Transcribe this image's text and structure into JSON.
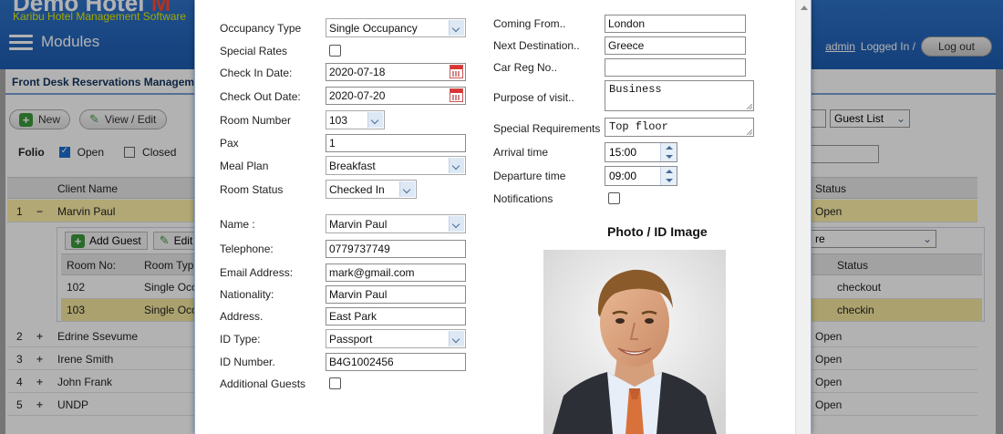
{
  "app": {
    "title_main": "Demo Hotel",
    "title_extra": "M",
    "subtitle": "Karibu Hotel Management Software",
    "modules": "Modules",
    "user": "admin",
    "logged_in": "Logged In /",
    "logout": "Log out",
    "header_bg": "#1f61b6"
  },
  "panel": {
    "title": "Front Desk Reservations Managem",
    "new_btn": "New",
    "edit_btn": "View / Edit",
    "folio_label": "Folio",
    "open_label": "Open",
    "closed_label": "Closed",
    "guest_list": "Guest List",
    "columns": {
      "client": "Client Name",
      "status": "Status"
    },
    "rows": [
      {
        "num": "1",
        "client": "Marvin Paul",
        "status": "Open",
        "expanded": true
      },
      {
        "num": "2",
        "client": "Edrine Ssevume",
        "status": "Open"
      },
      {
        "num": "3",
        "client": "Irene Smith",
        "status": "Open"
      },
      {
        "num": "4",
        "client": "John Frank",
        "status": "Open"
      },
      {
        "num": "5",
        "client": "UNDP",
        "status": "Open"
      }
    ],
    "sub": {
      "add_guest": "Add Guest",
      "edit_guest": "Edit G",
      "dropdown_tail": "re",
      "columns": {
        "room": "Room No:",
        "type": "Room Type",
        "status": "Status"
      },
      "rows": [
        {
          "room": "102",
          "type": "Single Occ",
          "status": "checkout"
        },
        {
          "room": "103",
          "type": "Single Occ",
          "status": "checkin"
        }
      ]
    }
  },
  "modal": {
    "labels": {
      "occupancy_type": "Occupancy Type",
      "special_rates": "Special Rates",
      "check_in": "Check In Date:",
      "check_out": "Check Out Date:",
      "room_number": "Room Number",
      "pax": "Pax",
      "meal_plan": "Meal Plan",
      "room_status": "Room Status",
      "name": "Name :",
      "telephone": "Telephone:",
      "email": "Email Address:",
      "nationality": "Nationality:",
      "address": "Address.",
      "id_type": "ID Type:",
      "id_number": "ID Number.",
      "additional_guests": "Additional Guests",
      "coming_from": "Coming From..",
      "next_destination": "Next Destination..",
      "car_reg": "Car Reg No..",
      "purpose": "Purpose of visit..",
      "special_requirements": "Special Requirements",
      "arrival_time": "Arrival time",
      "departure_time": "Departure time",
      "notifications": "Notifications",
      "photo_title": "Photo / ID Image"
    },
    "values": {
      "occupancy_type": "Single Occupancy",
      "check_in": "2020-07-18",
      "check_out": "2020-07-20",
      "room_number": "103",
      "pax": "1",
      "meal_plan": "Breakfast",
      "room_status": "Checked In",
      "name": "Marvin Paul",
      "telephone": "0779737749",
      "email": "mark@gmail.com",
      "nationality": "Marvin Paul",
      "address": "East Park",
      "id_type": "Passport",
      "id_number": "B4G1002456",
      "coming_from": "London",
      "next_destination": "Greece",
      "car_reg": "",
      "purpose": "Business",
      "special_requirements": "Top floor",
      "arrival_time": "15:00",
      "departure_time": "09:00"
    }
  }
}
